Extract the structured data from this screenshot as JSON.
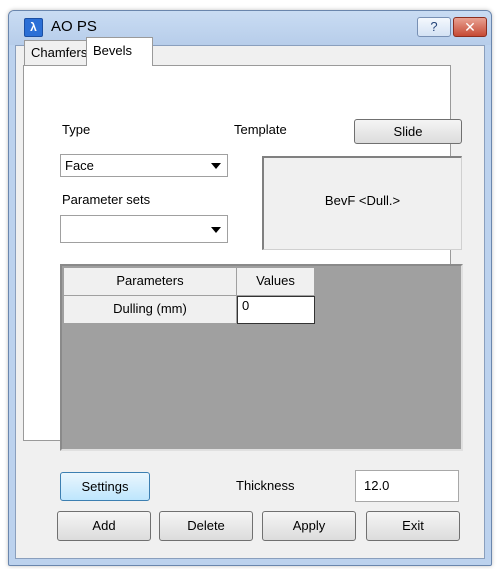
{
  "window": {
    "title": "AO PS",
    "app_icon_glyph": "λ",
    "help_glyph": "?",
    "close_glyph": "✕"
  },
  "tabs": [
    {
      "label": "Chamfers",
      "selected": false
    },
    {
      "label": "Bevels",
      "selected": true
    }
  ],
  "form": {
    "type_label": "Type",
    "type_value": "Face",
    "template_label": "Template",
    "slide_button": "Slide",
    "parameter_sets_label": "Parameter sets",
    "parameter_sets_value": "",
    "template_preview": "BevF  <Dull.>"
  },
  "grid": {
    "columns": [
      "Parameters",
      "Values"
    ],
    "rows": [
      {
        "parameter": "Dulling  (mm)",
        "value": "0"
      }
    ]
  },
  "footer": {
    "settings_button": "Settings",
    "thickness_label": "Thickness",
    "thickness_value": "12.0",
    "add_button": "Add",
    "delete_button": "Delete",
    "apply_button": "Apply",
    "exit_button": "Exit"
  },
  "colors": {
    "title_bar": "#bcd2ee",
    "close_button": "#c64a34",
    "grid_background": "#a0a0a0"
  }
}
